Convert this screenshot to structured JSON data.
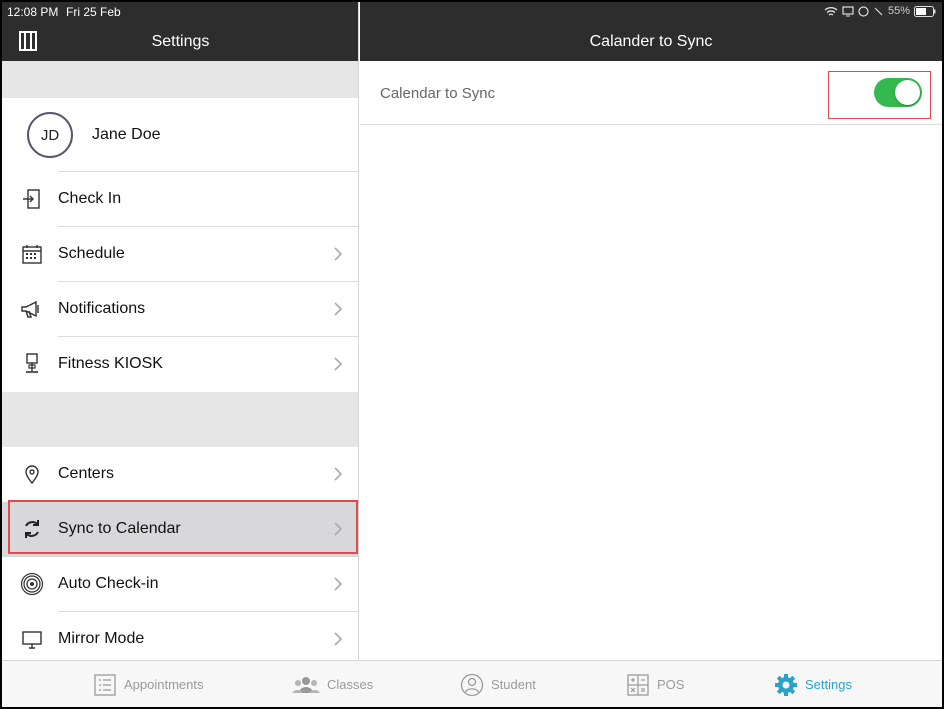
{
  "status": {
    "time": "12:08 PM",
    "date": "Fri 25 Feb",
    "battery": "55%"
  },
  "left": {
    "title": "Settings",
    "profile": {
      "initials": "JD",
      "name": "Jane Doe"
    },
    "items": [
      {
        "label": "Check In",
        "icon": "check-in-icon"
      },
      {
        "label": "Schedule",
        "icon": "calendar-icon"
      },
      {
        "label": "Notifications",
        "icon": "megaphone-icon"
      },
      {
        "label": "Fitness KIOSK",
        "icon": "kiosk-icon"
      },
      {
        "label": "Centers",
        "icon": "location-pin-icon"
      },
      {
        "label": "Sync to Calendar",
        "icon": "sync-icon"
      },
      {
        "label": "Auto Check-in",
        "icon": "broadcast-icon"
      },
      {
        "label": "Mirror Mode",
        "icon": "monitor-icon"
      }
    ]
  },
  "right": {
    "title": "Calander to Sync",
    "option_label": "Calendar to Sync",
    "toggle_on": true,
    "toggle_color": "#34b94f"
  },
  "tabbar": {
    "tabs": [
      {
        "label": "Appointments",
        "icon": "list-icon",
        "active": false
      },
      {
        "label": "Classes",
        "icon": "people-icon",
        "active": false
      },
      {
        "label": "Student",
        "icon": "person-icon",
        "active": false
      },
      {
        "label": "POS",
        "icon": "calculator-icon",
        "active": false
      },
      {
        "label": "Settings",
        "icon": "gear-icon",
        "active": true
      }
    ],
    "active_color": "#2aa3c8"
  }
}
